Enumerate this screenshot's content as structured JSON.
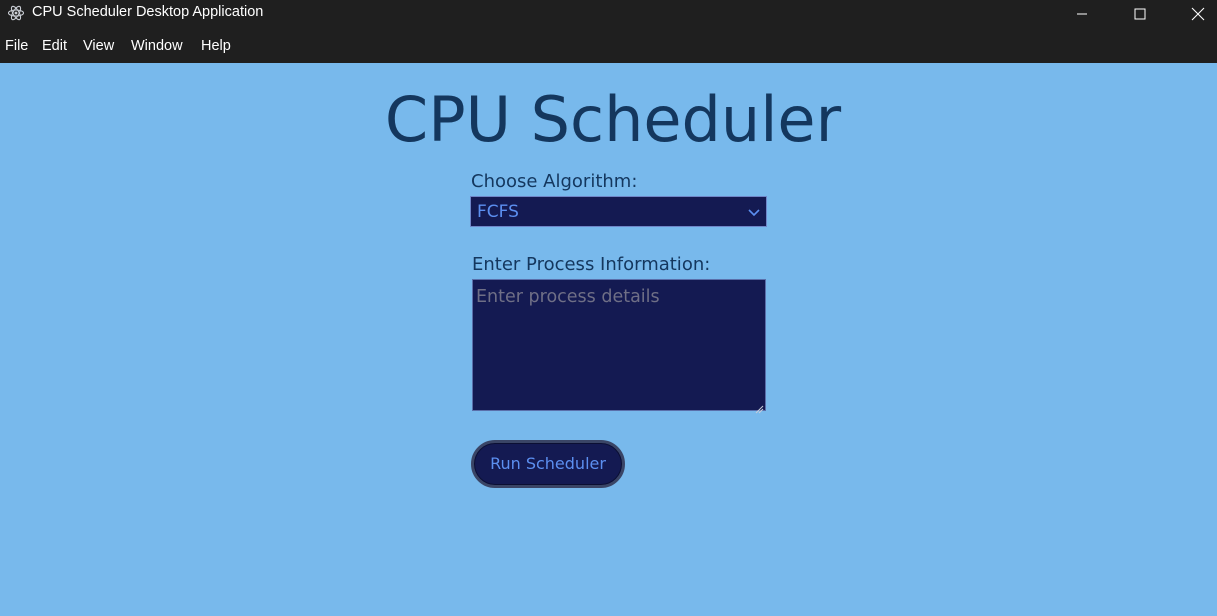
{
  "window": {
    "title": "CPU Scheduler Desktop Application",
    "icon": "electron-atom-icon"
  },
  "menu": {
    "items": [
      "File",
      "Edit",
      "View",
      "Window",
      "Help"
    ]
  },
  "main": {
    "title": "CPU Scheduler",
    "algorithm": {
      "label": "Choose Algorithm:",
      "selected": "FCFS"
    },
    "process": {
      "label": "Enter Process Information:",
      "placeholder": "Enter process details",
      "value": ""
    },
    "run_button": "Run Scheduler"
  },
  "colors": {
    "background": "#78b9ec",
    "title_text": "#14375e",
    "control_background": "#141a52",
    "accent_text": "#5c8ff0",
    "chrome": "#1f1f1f"
  }
}
